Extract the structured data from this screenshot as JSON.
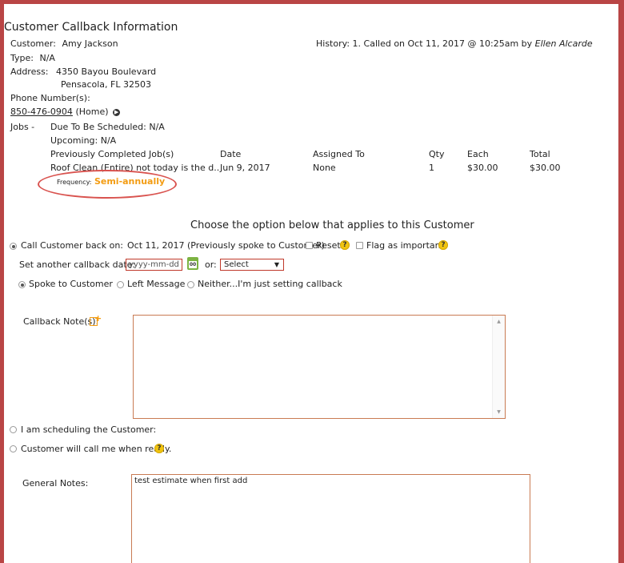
{
  "title": "Customer Callback Information",
  "customer": {
    "customer_label": "Customer:",
    "customer_name": "Amy Jackson",
    "type_label": "Type:",
    "type_value": "N/A",
    "address_label": "Address:",
    "address_line1": "4350 Bayou Boulevard",
    "address_line2": "Pensacola, FL 32503",
    "phone_label": "Phone Number(s):",
    "phone": "850-476-0904",
    "phone_type": "(Home)"
  },
  "history": {
    "label": "History:",
    "entry": "1. Called on Oct 11, 2017 @ 10:25am by",
    "by": "Ellen Alcarde"
  },
  "jobs": {
    "label": "Jobs -",
    "due_label": "Due To Be Scheduled:",
    "due_value": "N/A",
    "upcoming_label": "Upcoming:",
    "upcoming_value": "N/A",
    "columns": [
      "Previously Completed Job(s)",
      "Date",
      "Assigned To",
      "Qty",
      "Each",
      "Total"
    ],
    "rows": [
      [
        "Roof Clean (Entire) not today is the d..",
        "Jun 9, 2017",
        "None",
        "1",
        "$30.00",
        "$30.00"
      ]
    ],
    "frequency_label": "Frequency:",
    "frequency_value": "Semi-annually"
  },
  "options": {
    "heading": "Choose the option below that applies to this Customer",
    "callback_label": "Call Customer back on:",
    "callback_date": "Oct 11, 2017 (Previously spoke to Customer)",
    "reset_label": "Reset",
    "flag_label": "Flag as important",
    "set_date_label": "Set another callback date:",
    "date_placeholder": "yyyy-mm-dd",
    "or_label": "or:",
    "select_value": "Select",
    "spoke_label": "Spoke to Customer",
    "left_message_label": "Left Message",
    "neither_label": "Neither...I'm just setting callback",
    "notes_label": "Callback Note(s):",
    "scheduling_label": "I am scheduling the Customer:",
    "will_call_label": "Customer will call me when ready."
  },
  "general": {
    "label": "General Notes:",
    "value": "test estimate when first add"
  },
  "colors": {
    "accent": "#f39c12",
    "frame": "#b94545",
    "input_border": "#c0392b",
    "highlight": "#d9534f"
  }
}
